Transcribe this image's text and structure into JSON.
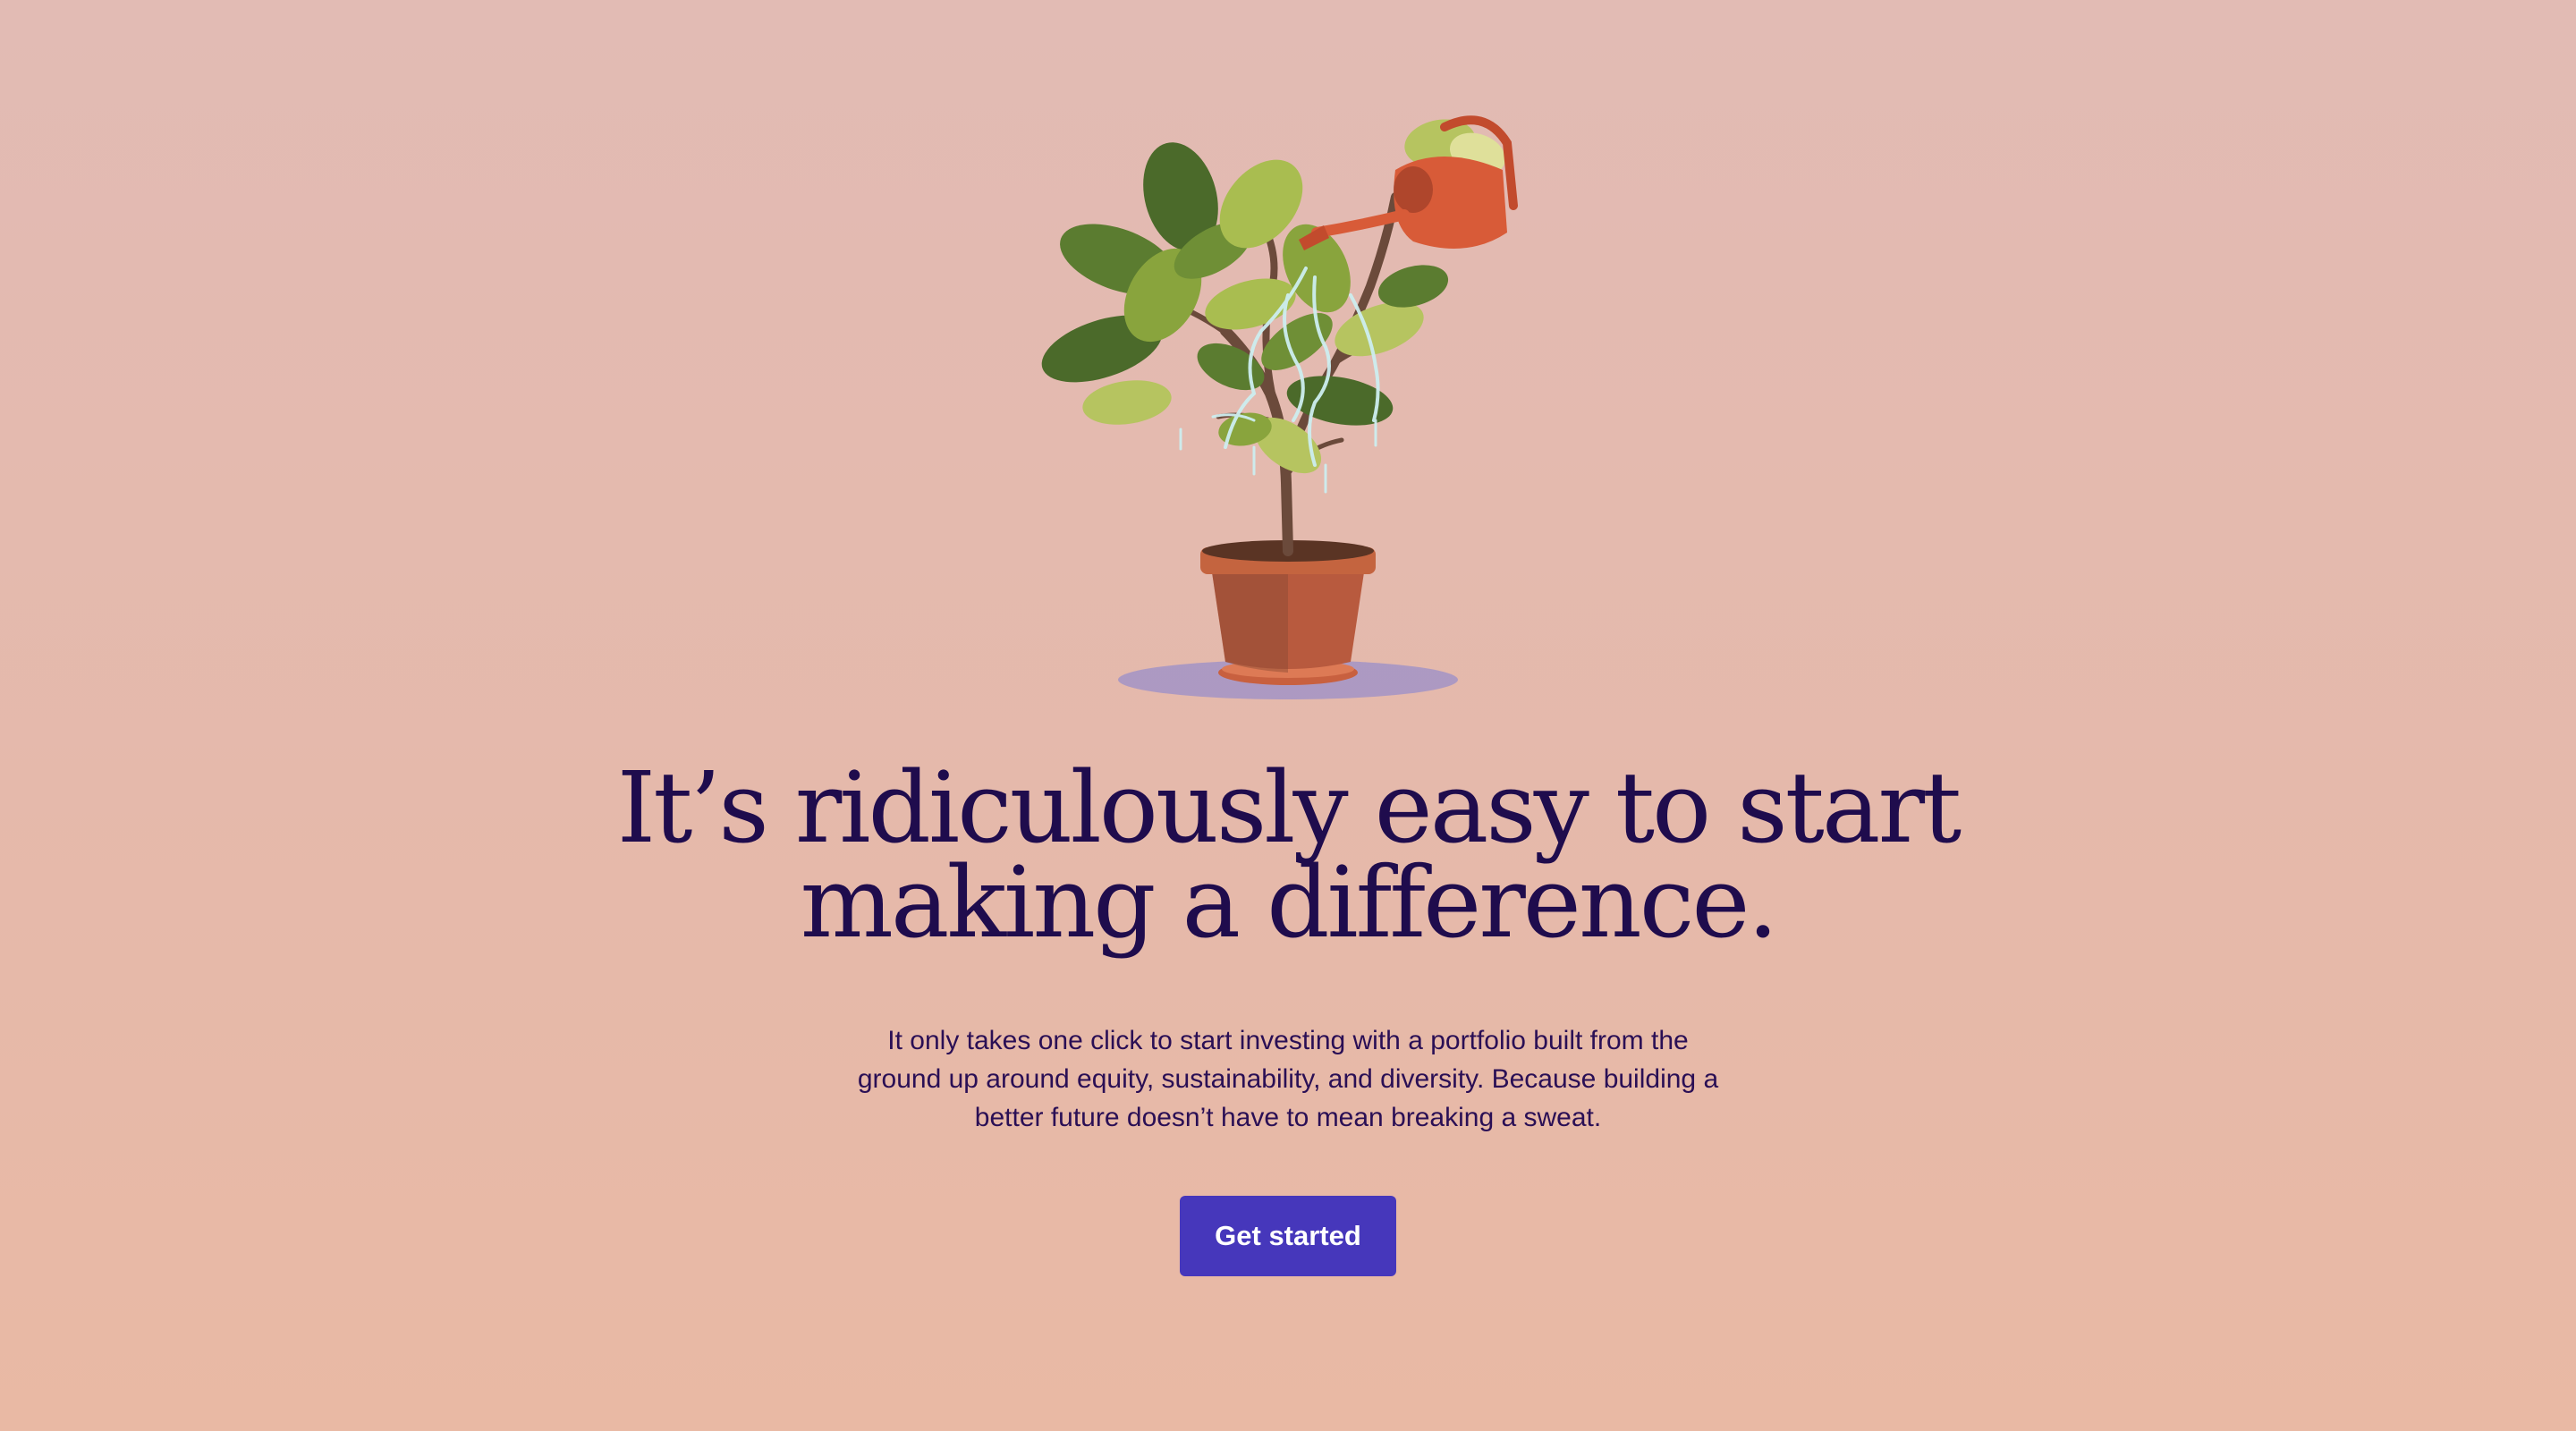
{
  "hero": {
    "headline": {
      "line1": "It’s ridiculously easy to start",
      "line2": "making a difference."
    },
    "subtext": {
      "line1": "It only takes one click to start investing with a portfolio built from the",
      "line2": "ground up around equity, sustainability, and diversity. Because building a",
      "line3": "better future doesn’t have to mean breaking a sweat."
    },
    "cta_label": "Get started",
    "illustration_icon": "watering-plant-illustration"
  },
  "colors": {
    "background": "#e4bab0",
    "headline": "#1f0c4d",
    "body_text": "#2a0f55",
    "button": "#4637bb",
    "button_text": "#ffffff",
    "pot": "#b85a3e",
    "watering_can": "#d85b38",
    "leaf_dark": "#4b6a2a",
    "leaf_light": "#b6c460",
    "water": "#cdeef0"
  }
}
